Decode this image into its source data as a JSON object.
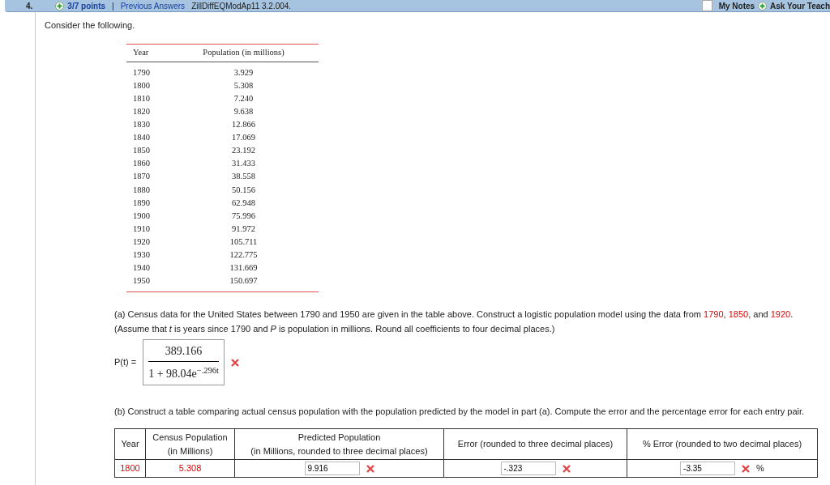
{
  "header": {
    "number": "4.",
    "points": "3/7 points",
    "separator": "|",
    "previous_answers": "Previous Answers",
    "problem_id": "ZillDiffEQModAp11 3.2.004.",
    "notes_checked": false,
    "my_notes": "My Notes",
    "ask_teacher": "Ask Your Teach"
  },
  "intro": "Consider the following.",
  "data_table": {
    "columns": [
      "Year",
      "Population (in millions)"
    ],
    "rows": [
      [
        "1790",
        "3.929"
      ],
      [
        "1800",
        "5.308"
      ],
      [
        "1810",
        "7.240"
      ],
      [
        "1820",
        "9.638"
      ],
      [
        "1830",
        "12.866"
      ],
      [
        "1840",
        "17.069"
      ],
      [
        "1850",
        "23.192"
      ],
      [
        "1860",
        "31.433"
      ],
      [
        "1870",
        "38.558"
      ],
      [
        "1880",
        "50.156"
      ],
      [
        "1890",
        "62.948"
      ],
      [
        "1900",
        "75.996"
      ],
      [
        "1910",
        "91.972"
      ],
      [
        "1920",
        "105.711"
      ],
      [
        "1930",
        "122.775"
      ],
      [
        "1940",
        "131.669"
      ],
      [
        "1950",
        "150.697"
      ]
    ]
  },
  "part_a": {
    "segments": [
      {
        "text": "(a) Census data for the United States between 1790 and 1950 are given in the table above. Construct a logistic population model using the data from ",
        "highlight": false
      },
      {
        "text": "1790",
        "highlight": true
      },
      {
        "text": ", ",
        "highlight": false
      },
      {
        "text": "1850",
        "highlight": true
      },
      {
        "text": ", and ",
        "highlight": false
      },
      {
        "text": "1920",
        "highlight": true
      },
      {
        "text": ". (Assume that *t* is years since 1790 and *P* is population in millions. Round all coefficients to four decimal places.)",
        "highlight": false
      }
    ],
    "label": "P(t) =",
    "numerator": "389.166",
    "denominator": "1 + 98.04e$^{−.296t}$",
    "correct": false
  },
  "part_b": {
    "text": "(b) Construct a table comparing actual census population with the population predicted by the model in part (a). Compute the error and the percentage error for each entry pair.",
    "columns": [
      [
        "Year"
      ],
      [
        "Census Population",
        "(in Millions)"
      ],
      [
        "Predicted Population",
        "(in Millions, rounded to three decimal places)"
      ],
      [
        "Error (rounded to three decimal places)"
      ],
      [
        "% Error (rounded to two decimal places)"
      ]
    ],
    "rows": [
      {
        "year": "1800",
        "census": "5.308",
        "predicted": {
          "value": "9.916",
          "correct": false
        },
        "error": {
          "value": "-.323",
          "correct": false
        },
        "percent_error": {
          "value": "-3.35",
          "correct": false
        },
        "unit": "%"
      }
    ]
  }
}
